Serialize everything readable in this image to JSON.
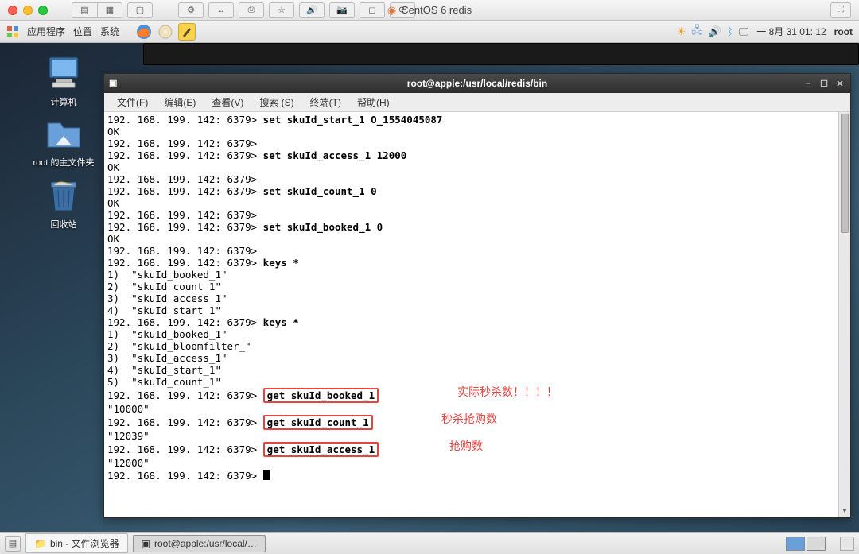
{
  "mac_toolbar": {
    "title": "CentOS 6 redis",
    "tool_glyphs": [
      "⚙",
      "↔",
      "⎙",
      "☆",
      "🔊",
      "📷",
      "◻",
      "⟳"
    ]
  },
  "gnome": {
    "menu_apps": "应用程序",
    "menu_pos": "位置",
    "menu_sys": "系统",
    "clock": "一  8月  31 01: 12",
    "user": "root"
  },
  "desktop_icons": {
    "computer": "计算机",
    "home": "root 的主文件夹",
    "trash": "回收站"
  },
  "terminal": {
    "title": "root@apple:/usr/local/redis/bin",
    "menu": [
      "文件(F)",
      "编辑(E)",
      "查看(V)",
      "搜索 (S)",
      "终端(T)",
      "帮助(H)"
    ],
    "prompt": "192. 168. 199. 142: 6379>",
    "lines": [
      {
        "t": "cmd",
        "cmd": "set skuId_start_1 O_1554045087"
      },
      {
        "t": "out",
        "text": "OK"
      },
      {
        "t": "prompt"
      },
      {
        "t": "cmd",
        "cmd": "set skuId_access_1 12000"
      },
      {
        "t": "out",
        "text": "OK"
      },
      {
        "t": "prompt"
      },
      {
        "t": "cmd",
        "cmd": "set skuId_count_1 0"
      },
      {
        "t": "out",
        "text": "OK"
      },
      {
        "t": "prompt"
      },
      {
        "t": "cmd",
        "cmd": "set skuId_booked_1 0"
      },
      {
        "t": "out",
        "text": "OK"
      },
      {
        "t": "prompt"
      },
      {
        "t": "cmd",
        "cmd": "keys *"
      },
      {
        "t": "out",
        "text": "1)  \"skuId_booked_1\""
      },
      {
        "t": "out",
        "text": "2)  \"skuId_count_1\""
      },
      {
        "t": "out",
        "text": "3)  \"skuId_access_1\""
      },
      {
        "t": "out",
        "text": "4)  \"skuId_start_1\""
      },
      {
        "t": "cmd",
        "cmd": "keys *"
      },
      {
        "t": "out",
        "text": "1)  \"skuId_booked_1\""
      },
      {
        "t": "out",
        "text": "2)  \"skuId_bloomfilter_\""
      },
      {
        "t": "out",
        "text": "3)  \"skuId_access_1\""
      },
      {
        "t": "out",
        "text": "4)  \"skuId_start_1\""
      },
      {
        "t": "out",
        "text": "5)  \"skuId_count_1\""
      },
      {
        "t": "cmdbox",
        "cmd": "get skuId_booked_1",
        "note": "实际秒杀数！！！！"
      },
      {
        "t": "out",
        "text": "\"10000\""
      },
      {
        "t": "cmdbox",
        "cmd": "get skuId_count_1",
        "note": "秒杀抢购数"
      },
      {
        "t": "out",
        "text": "\"12039\""
      },
      {
        "t": "cmdbox",
        "cmd": "get skuId_access_1",
        "note": "抢购数"
      },
      {
        "t": "out",
        "text": "\"12000\""
      },
      {
        "t": "cursor"
      }
    ]
  },
  "taskbar": {
    "task1": "bin - 文件浏览器",
    "task2": "root@apple:/usr/local/…"
  }
}
